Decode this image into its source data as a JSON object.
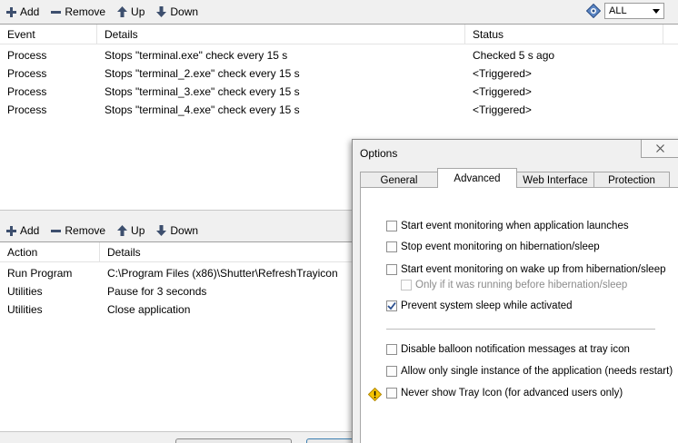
{
  "top_toolbar": {
    "add": "Add",
    "remove": "Remove",
    "up": "Up",
    "down": "Down",
    "filter_value": "ALL"
  },
  "events_table": {
    "columns": [
      "Event",
      "Details",
      "Status"
    ],
    "rows": [
      {
        "event": "Process",
        "details": "Stops \"terminal.exe\" check every 15 s",
        "status": "Checked 5 s ago"
      },
      {
        "event": "Process",
        "details": "Stops \"terminal_2.exe\" check every 15 s",
        "status": "<Triggered>"
      },
      {
        "event": "Process",
        "details": "Stops \"terminal_3.exe\" check every 15 s",
        "status": "<Triggered>"
      },
      {
        "event": "Process",
        "details": "Stops \"terminal_4.exe\" check every 15 s",
        "status": "<Triggered>"
      }
    ]
  },
  "bottom_toolbar": {
    "add": "Add",
    "remove": "Remove",
    "up": "Up",
    "down": "Down"
  },
  "actions_table": {
    "columns": [
      "Action",
      "Details"
    ],
    "rows": [
      {
        "action": "Run Program",
        "details": "C:\\Program Files (x86)\\Shutter\\RefreshTrayicon"
      },
      {
        "action": "Utilities",
        "details": "Pause for 3 seconds"
      },
      {
        "action": "Utilities",
        "details": "Close application"
      }
    ]
  },
  "options_dialog": {
    "title": "Options",
    "tabs": [
      "General",
      "Advanced",
      "Web Interface",
      "Protection"
    ],
    "active_tab": "Advanced",
    "options": [
      {
        "label": "Start event monitoring when application launches",
        "checked": false
      },
      {
        "label": "Stop event monitoring on hibernation/sleep",
        "checked": false
      },
      {
        "label": "Start event monitoring on wake up from hibernation/sleep",
        "checked": false
      },
      {
        "label": "Only if it was running before hibernation/sleep",
        "checked": false,
        "disabled": true
      },
      {
        "label": "Prevent system sleep while activated",
        "checked": true
      },
      {
        "label": "Disable balloon notification messages at tray icon",
        "checked": false
      },
      {
        "label": "Allow only single instance of the application (needs restart)",
        "checked": false
      },
      {
        "label": "Never show Tray Icon (for advanced users only)",
        "checked": false,
        "warning": true
      }
    ]
  },
  "colors": {
    "accent_blue": "#3b6fb6",
    "check_blue": "#2a4f8f",
    "warning_yellow": "#f5c400"
  }
}
